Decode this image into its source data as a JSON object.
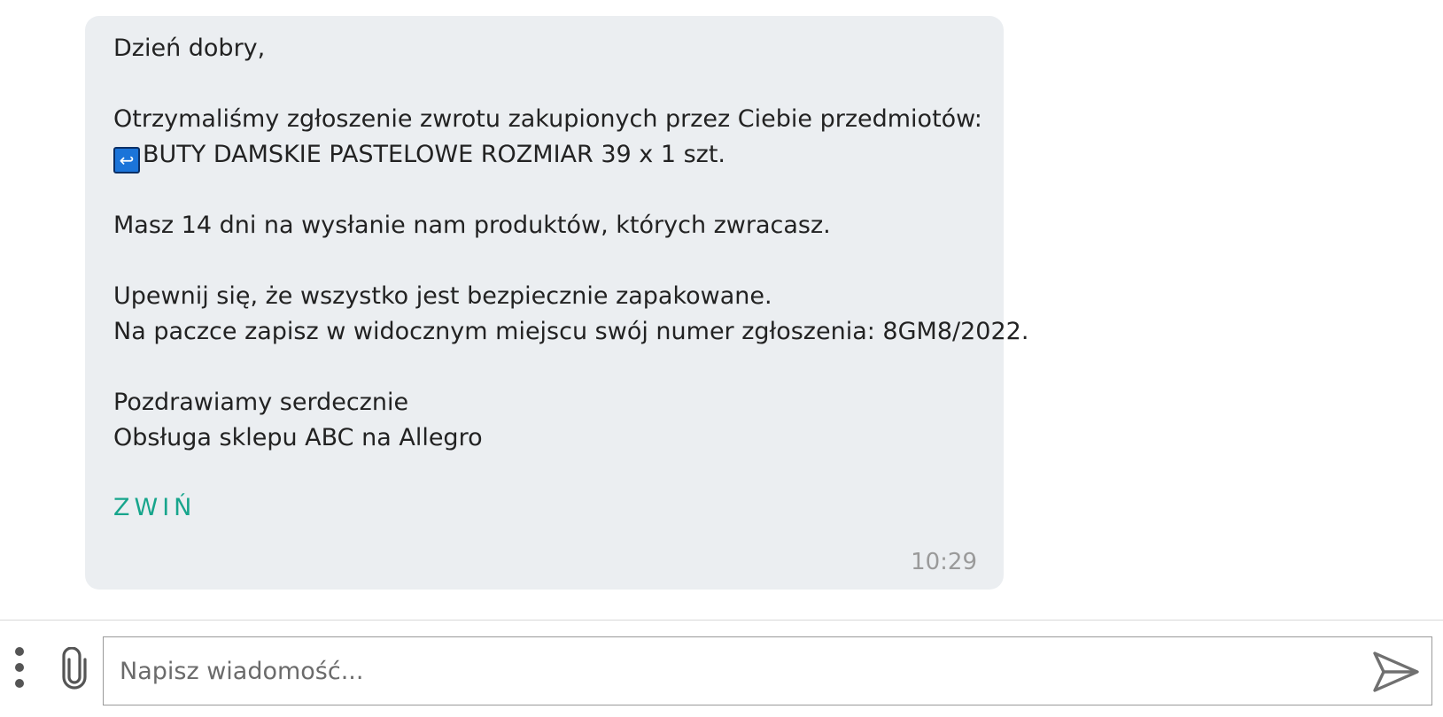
{
  "message": {
    "greeting": "Dzień dobry,",
    "intro": "Otrzymaliśmy zgłoszenie zwrotu zakupionych przez Ciebie przedmiotów:",
    "item_icon": "return-arrow-emoji",
    "item_icon_glyph": "↩",
    "item": "BUTY DAMSKIE PASTELOWE ROZMIAR 39 x 1 szt.",
    "deadline": "Masz 14 dni na wysłanie nam produktów, których zwracasz.",
    "packing": "Upewnij się, że wszystko jest bezpiecznie zapakowane.",
    "ticket": "Na paczce zapisz w widocznym miejscu swój numer zgłoszenia: 8GM8/2022.",
    "regards": "Pozdrawiamy serdecznie",
    "signature": "Obsługa sklepu ABC na Allegro",
    "collapse_label": "ZWIŃ",
    "time": "10:29"
  },
  "composer": {
    "placeholder": "Napisz wiadomość...",
    "value": "",
    "more_icon": "vertical-ellipsis-icon",
    "attach_icon": "paperclip-icon",
    "send_icon": "send-icon"
  },
  "colors": {
    "bubble_background": "#ebeef1",
    "accent": "#17a58c",
    "timestamp": "#9a9a9a",
    "text": "#222222",
    "emoji_blue": "#1b74d9"
  }
}
